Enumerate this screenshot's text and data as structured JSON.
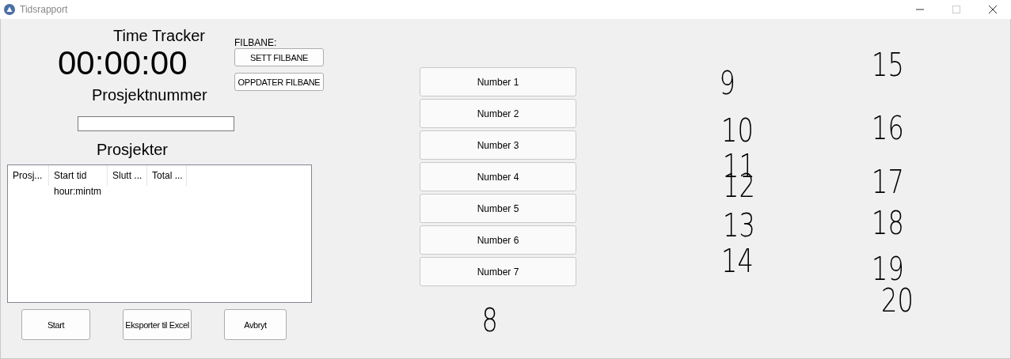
{
  "window": {
    "title": "Tidsrapport"
  },
  "header": {
    "title": "Time Tracker",
    "clock": "00:00:00",
    "project_label": "Prosjektnummer"
  },
  "filbane": {
    "label": "FILBANE:",
    "buttons": [
      "SETT FILBANE",
      "OPPDATER FILBANE"
    ]
  },
  "projects": {
    "title": "Prosjekter",
    "columns": [
      "Prosj...",
      "Start tid",
      "Slutt ...",
      "Total ..."
    ],
    "rows": [
      [
        "",
        "hour:mintm",
        "",
        ""
      ]
    ]
  },
  "actions": [
    "Start",
    "Eksporter til Excel",
    "Avbryt"
  ],
  "numbers": [
    "Number 1",
    "Number 2",
    "Number 3",
    "Number 4",
    "Number 5",
    "Number 6",
    "Number 7"
  ],
  "handwritten_marks": [
    "9",
    "10",
    "11",
    "12",
    "13",
    "14",
    "15",
    "16",
    "17",
    "18",
    "19",
    "20",
    "8"
  ]
}
